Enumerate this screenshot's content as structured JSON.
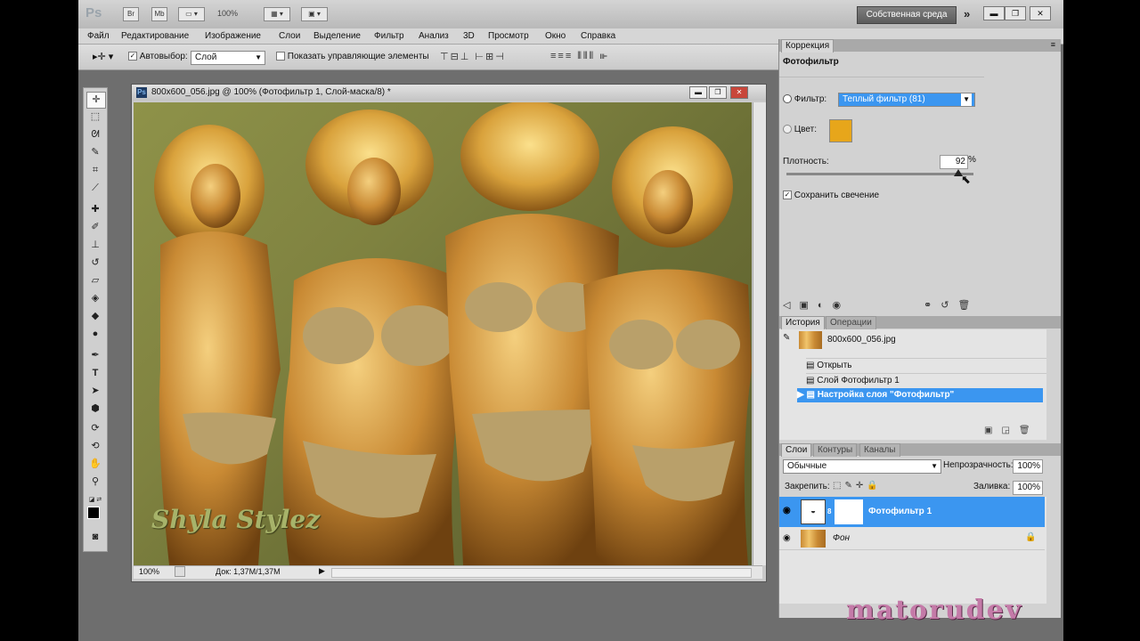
{
  "appbar": {
    "logo": "Ps",
    "br": "Br",
    "mb": "Mb",
    "zoom": "100%",
    "workspace": "Собственная среда",
    "chevron": "»"
  },
  "menu": [
    "Файл",
    "Редактирование",
    "Изображение",
    "Слои",
    "Выделение",
    "Фильтр",
    "Анализ",
    "3D",
    "Просмотр",
    "Окно",
    "Справка"
  ],
  "options": {
    "autoselect_label": "Автовыбор:",
    "autoselect_value": "Слой",
    "show_controls": "Показать управляющие элементы"
  },
  "document": {
    "title": "800x600_056.jpg @ 100% (Фотофильтр 1, Слой-маска/8) *",
    "zoom": "100%",
    "doc_info": "Док: 1,37M/1,37M",
    "photo_caption": "Shyla Stylez"
  },
  "correction": {
    "tab": "Коррекция",
    "heading": "Фотофильтр",
    "filter_label": "Фильтр:",
    "filter_value": "Теплый фильтр (81)",
    "color_label": "Цвет:",
    "color_swatch": "#e7a61b",
    "density_label": "Плотность:",
    "density_value": "92",
    "density_unit": "%",
    "density_fraction": 0.92,
    "preserve_label": "Сохранить свечение"
  },
  "history": {
    "tabs": [
      "История",
      "Операции"
    ],
    "snapshot": "800x600_056.jpg",
    "items": [
      "Открыть",
      "Слой Фотофильтр 1",
      "Настройка слоя \"Фотофильтр\""
    ]
  },
  "layers": {
    "tabs": [
      "Слои",
      "Контуры",
      "Каналы"
    ],
    "blend_mode": "Обычные",
    "opacity_label": "Непрозрачность:",
    "opacity_value": "100%",
    "lock_label": "Закрепить:",
    "fill_label": "Заливка:",
    "fill_value": "100%",
    "items": [
      {
        "name": "Фотофильтр 1"
      },
      {
        "name": "Фон"
      }
    ]
  },
  "watermark": "matorudev",
  "colors": {
    "selection": "#3b96f0",
    "accent": "#e7a61b"
  }
}
